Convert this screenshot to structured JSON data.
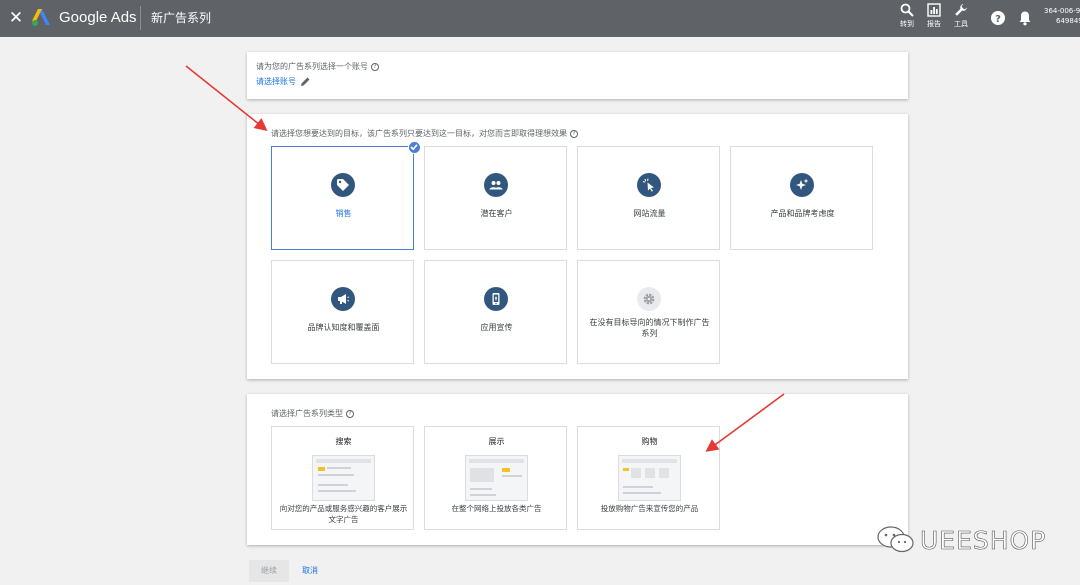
{
  "header": {
    "brand": "Google Ads",
    "title": "新广告系列",
    "tools": [
      {
        "label": "转到",
        "icon": "search-icon"
      },
      {
        "label": "报告",
        "icon": "bar-chart-icon"
      },
      {
        "label": "工具",
        "icon": "wrench-icon"
      }
    ],
    "help_icon": "help-icon",
    "bell_icon": "bell-icon",
    "account_line1": "364-006-9",
    "account_line2": "649849"
  },
  "account_section": {
    "label": "请为您的广告系列选择一个账号",
    "select_link": "请选择账号"
  },
  "goal_section": {
    "label": "请选择您想要达到的目标，该广告系列只要达到这一目标，对您而言即取得理想效果",
    "goals": [
      {
        "label": "销售",
        "icon": "tag-icon",
        "selected": true
      },
      {
        "label": "潜在客户",
        "icon": "people-icon",
        "selected": false
      },
      {
        "label": "网站流量",
        "icon": "cursor-click-icon",
        "selected": false
      },
      {
        "label": "产品和品牌考虑度",
        "icon": "sparkle-icon",
        "selected": false
      },
      {
        "label": "品牌认知度和覆盖面",
        "icon": "megaphone-icon",
        "selected": false
      },
      {
        "label": "应用宣传",
        "icon": "phone-icon",
        "selected": false
      },
      {
        "label": "在没有目标导向的情况下制作广告系列",
        "icon": "gear-icon",
        "selected": false
      }
    ]
  },
  "type_section": {
    "label": "请选择广告系列类型",
    "types": [
      {
        "title": "搜索",
        "desc": "向对您的产品或服务感兴趣的客户展示文字广告"
      },
      {
        "title": "展示",
        "desc": "在整个网络上投放各类广告"
      },
      {
        "title": "购物",
        "desc": "投放购物广告来宣传您的产品"
      }
    ]
  },
  "footer": {
    "continue_label": "继续",
    "cancel_label": "取消"
  },
  "watermark": {
    "text": "UEESHOP"
  },
  "colors": {
    "topbar": "#5f6368",
    "goal_icon_bg": "#32577f",
    "accent": "#1a73e8",
    "annotation_arrow": "#e53935"
  }
}
